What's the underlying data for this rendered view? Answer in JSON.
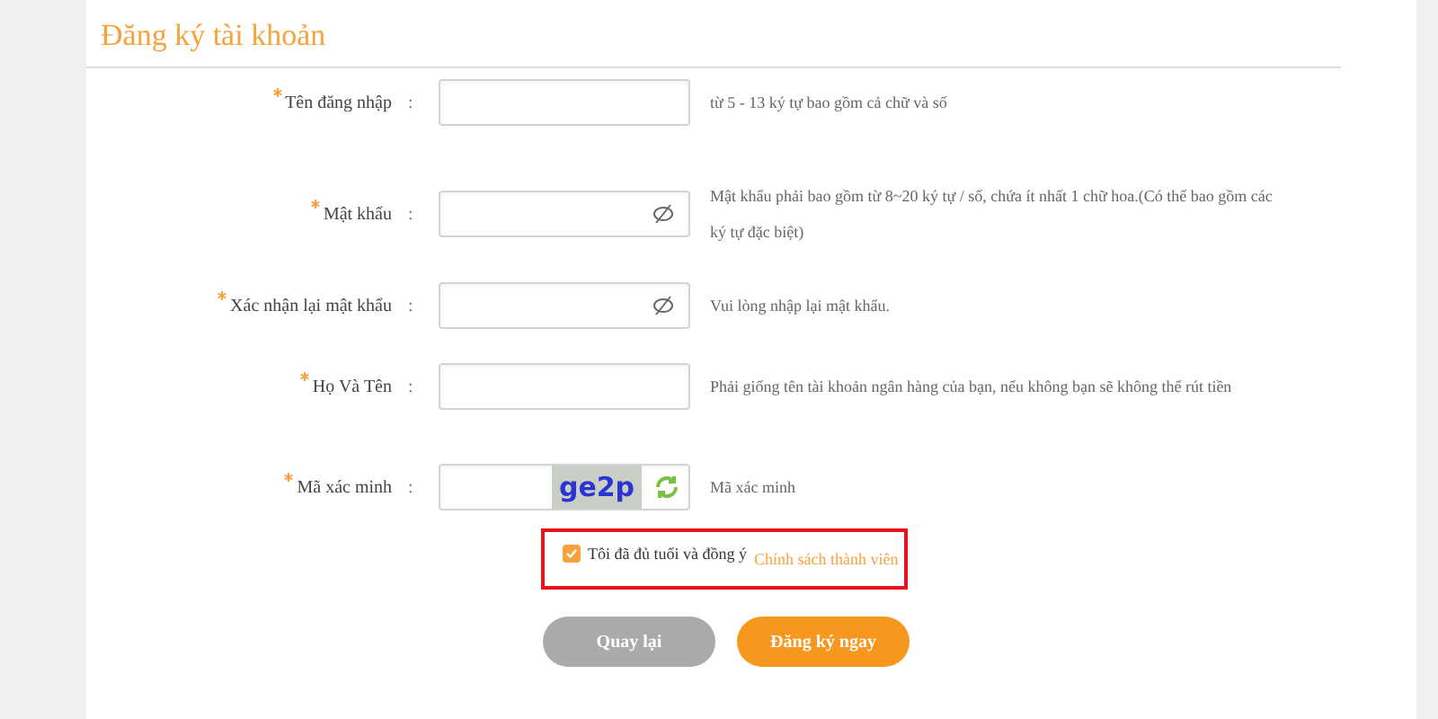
{
  "title": "Đăng ký tài khoản",
  "fields": [
    {
      "kind": "text",
      "label": "Tên đăng nhập",
      "required": true,
      "colon": ":",
      "hint": "từ 5 - 13 ký tự bao gồm cả chữ và số"
    },
    {
      "kind": "password",
      "label": "Mật khẩu",
      "required": true,
      "colon": ":",
      "hint": "Mật khẩu phải bao gồm từ 8~20 ký tự / số, chứa ít nhất 1 chữ hoa.(Có thể bao gồm các ký tự đặc biệt)"
    },
    {
      "kind": "password",
      "label": "Xác nhận lại mật khẩu",
      "required": true,
      "colon": ":",
      "hint": "Vui lòng nhập lại mật khẩu."
    },
    {
      "kind": "text",
      "label": "Họ Và Tên",
      "required": true,
      "colon": ":",
      "hint": "Phải giống tên tài khoản ngân hàng của bạn, nếu không bạn sẽ không thể rút tiền"
    },
    {
      "kind": "captcha",
      "label": "Mã xác minh",
      "required": true,
      "colon": ":",
      "captcha_text": "ge2p",
      "hint": "Mã xác minh"
    }
  ],
  "agreement": {
    "checked": true,
    "highlighted": true,
    "text": "Tôi đã đủ tuổi và đồng ý",
    "link": "Chính sách thành viên"
  },
  "buttons": [
    {
      "kind": "secondary",
      "label": "Quay lại"
    },
    {
      "kind": "primary",
      "label": "Đăng ký ngay"
    }
  ]
}
